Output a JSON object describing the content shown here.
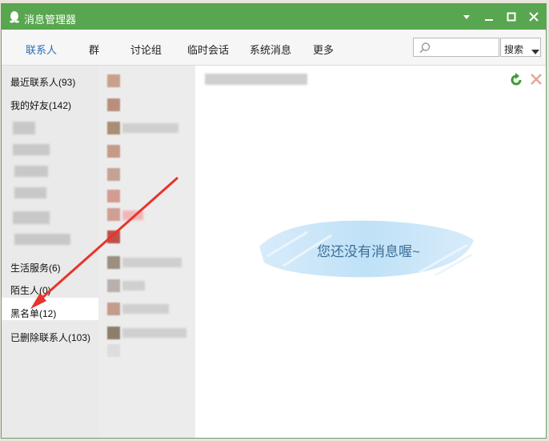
{
  "window": {
    "title": "消息管理器"
  },
  "tabs": [
    {
      "label": "联系人",
      "active": true
    },
    {
      "label": "群",
      "active": false
    },
    {
      "label": "讨论组",
      "active": false
    },
    {
      "label": "临时会话",
      "active": false
    },
    {
      "label": "系统消息",
      "active": false
    },
    {
      "label": "更多",
      "active": false
    }
  ],
  "search": {
    "button_label": "搜索",
    "value": ""
  },
  "sidebar": {
    "items": [
      {
        "label": "最近联系人(93)"
      },
      {
        "label": "我的好友(142)"
      },
      {
        "label": "生活服务(6)"
      },
      {
        "label": "陌生人(0)"
      },
      {
        "label": "黑名单(12)",
        "selected": true
      },
      {
        "label": "已删除联系人(103)"
      }
    ]
  },
  "content": {
    "empty_message": "您还没有消息喔~"
  },
  "colors": {
    "titlebar": "#58a64f",
    "active_tab": "#2a6fb8",
    "annotation_arrow": "#e8342a"
  }
}
